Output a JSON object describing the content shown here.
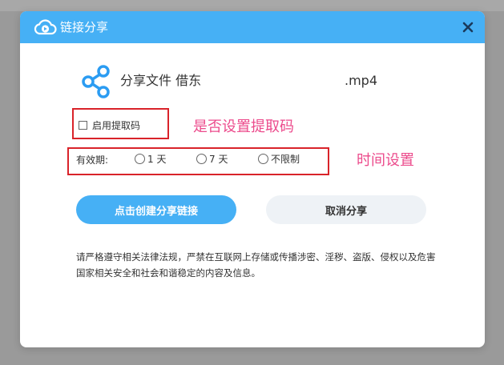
{
  "dialog": {
    "title": "链接分享",
    "close_icon": "close-icon"
  },
  "file": {
    "label": "分享文件 借东",
    "extension": ".mp4",
    "icon": "share-icon"
  },
  "options": {
    "enable_password_label": "启用提取码",
    "enable_password_checked": false,
    "validity_label": "有效期:",
    "validity_options": [
      "1 天",
      "7 天",
      "不限制"
    ]
  },
  "annotations": {
    "password_note": "是否设置提取码",
    "time_note": "时间设置",
    "color": "#ec4b8c",
    "box_color": "#d9232a"
  },
  "buttons": {
    "create_label": "点击创建分享链接",
    "cancel_label": "取消分享"
  },
  "notice": "请严格遵守相关法律法规，严禁在互联网上存储或传播涉密、淫秽、盗版、侵权以及危害国家相关安全和社会和谐稳定的内容及信息。",
  "colors": {
    "accent": "#46b0f5",
    "secondary_button": "#eef2f6"
  }
}
